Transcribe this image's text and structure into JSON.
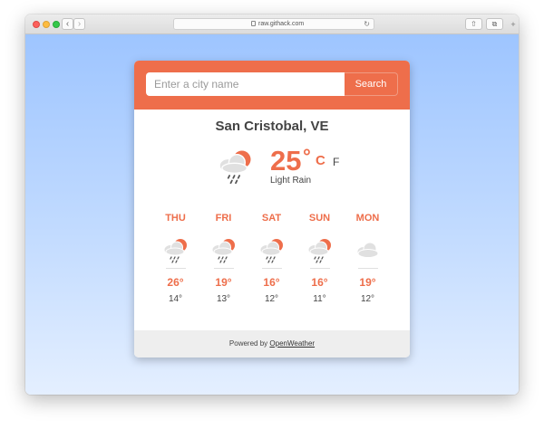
{
  "browser": {
    "url": "raw.githack.com",
    "icons": {
      "back": "chevron-left-icon",
      "forward": "chevron-right-icon",
      "lock": "lock-icon",
      "reload": "reload-icon",
      "share": "share-icon",
      "tabs": "tabs-icon",
      "new_tab": "plus-icon"
    }
  },
  "colors": {
    "accent": "#ee6e4b",
    "background_top": "#9ec5ff",
    "background_bottom": "#e4efff",
    "footer_bg": "#eeeeee",
    "cloud": "#e0e0e0",
    "sun": "#ee6e4b",
    "rain": "#555555"
  },
  "search": {
    "placeholder": "Enter a city name",
    "value": "",
    "button_label": "Search"
  },
  "current": {
    "city": "San Cristobal, VE",
    "temp": "25",
    "degree": "°",
    "unit_c": "C",
    "unit_f": "F",
    "description": "Light Rain",
    "icon": "cloud-sun-rain-icon"
  },
  "forecast": [
    {
      "day": "THU",
      "high": "26°",
      "low": "14°",
      "icon": "cloud-sun-rain-icon"
    },
    {
      "day": "FRI",
      "high": "19°",
      "low": "13°",
      "icon": "cloud-sun-rain-icon"
    },
    {
      "day": "SAT",
      "high": "16°",
      "low": "12°",
      "icon": "cloud-sun-rain-icon"
    },
    {
      "day": "SUN",
      "high": "16°",
      "low": "11°",
      "icon": "cloud-sun-rain-icon"
    },
    {
      "day": "MON",
      "high": "19°",
      "low": "12°",
      "icon": "cloud-icon"
    }
  ],
  "footer": {
    "prefix": "Powered by ",
    "link": "OpenWeather"
  }
}
